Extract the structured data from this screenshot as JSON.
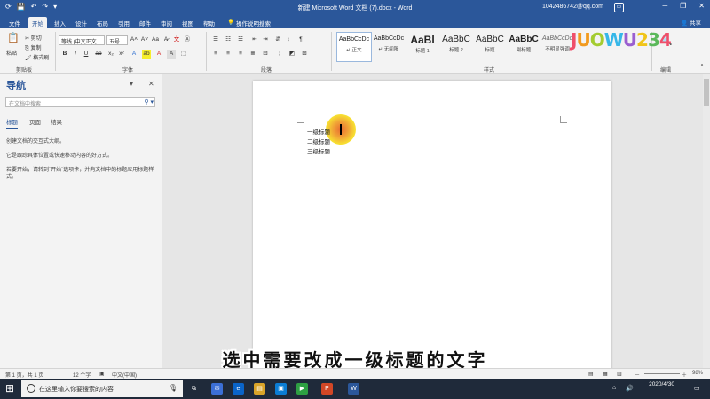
{
  "titlebar": {
    "doc_title": "新建 Microsoft Word 文档 (7).docx - Word",
    "account": "1042486742@qq.com",
    "quick_access": [
      "💾",
      "↶",
      "↷",
      "▾"
    ]
  },
  "tabs": [
    {
      "label": "文件"
    },
    {
      "label": "开始",
      "active": true
    },
    {
      "label": "插入"
    },
    {
      "label": "设计"
    },
    {
      "label": "布局"
    },
    {
      "label": "引用"
    },
    {
      "label": "邮件"
    },
    {
      "label": "审阅"
    },
    {
      "label": "视图"
    },
    {
      "label": "帮助"
    },
    {
      "label": "操作说明搜索"
    }
  ],
  "share_label": "共享",
  "ribbon": {
    "clipboard": {
      "paste": "粘贴",
      "cut": "剪切",
      "copy": "复制",
      "format_painter": "格式刷",
      "group": "剪贴板"
    },
    "font": {
      "name": "等线 (中文正文",
      "size": "五号",
      "group": "字体"
    },
    "paragraph": {
      "group": "段落"
    },
    "styles": {
      "group": "样式",
      "items": [
        {
          "sample": "AaBbCcDc",
          "name": "↵ 正文"
        },
        {
          "sample": "AaBbCcDc",
          "name": "↵ 无间隔"
        },
        {
          "sample": "AaBl",
          "name": "标题 1"
        },
        {
          "sample": "AaBbC",
          "name": "标题 2"
        },
        {
          "sample": "AaBbC",
          "name": "标题"
        },
        {
          "sample": "AaBbC",
          "name": "副标题"
        },
        {
          "sample": "AaBbCcDc",
          "name": "不明显强调"
        }
      ]
    },
    "editing": {
      "group": "编辑"
    }
  },
  "nav": {
    "title": "导航",
    "search_placeholder": "在文档中搜索",
    "tabs": [
      "标题",
      "页面",
      "结果"
    ],
    "texts": [
      "创建文档的交互式大纲。",
      "它是跟踪具体位置或快速移动内容的好方式。",
      "若要开始，请转到\"开始\"选项卡，并向文档中的标题应用标题样式。"
    ]
  },
  "document": {
    "lines": [
      "一级标题",
      "二级标题",
      "三级标题"
    ]
  },
  "subtitle": "选中需要改成一级标题的文字",
  "statusbar": {
    "page": "第 1 页，共 1 页",
    "words": "12 个字",
    "lang": "中文(中国)",
    "zoom": "98%"
  },
  "taskbar": {
    "search_placeholder": "在这里输入你要搜索的内容",
    "time": "",
    "date": "2020/4/30"
  },
  "watermark": "JUOWU234"
}
